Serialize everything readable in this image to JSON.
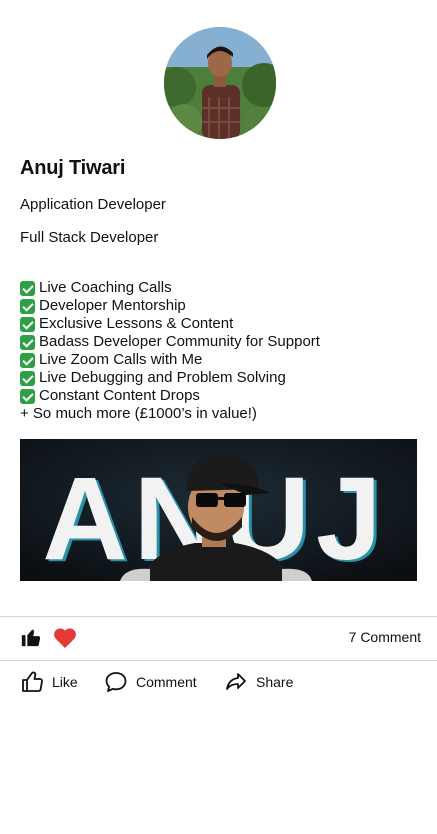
{
  "profile": {
    "name": "Anuj Tiwari",
    "title_1": "Application Developer",
    "title_2": "Full Stack Developer"
  },
  "features": [
    "Live Coaching Calls",
    "Developer Mentorship",
    "Exclusive Lessons & Content",
    "Badass Developer Community for Support",
    "Live Zoom Calls with Me",
    "Live Debugging and Problem Solving",
    "Constant Content Drops"
  ],
  "extra_line": "+ So much more (£1000’s in value!)",
  "banner": {
    "text": "ANUJ"
  },
  "reactions": {
    "comment_count": "7 Comment"
  },
  "actions": {
    "like": "Like",
    "comment": "Comment",
    "share": "Share"
  },
  "colors": {
    "check": "#2f9e44",
    "heart": "#e53935",
    "divider": "#d6d6d6"
  }
}
